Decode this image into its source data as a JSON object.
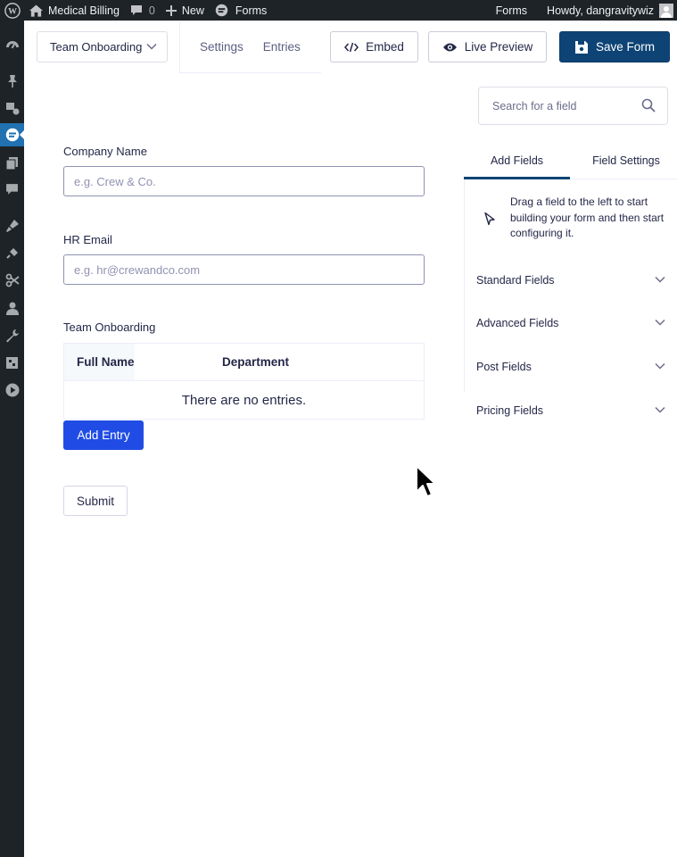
{
  "adminbar": {
    "site_name": "Medical Billing",
    "comments_count": "0",
    "new_label": "New",
    "forms_label": "Forms",
    "right_forms_label": "Forms",
    "greeting": "Howdy, dangravitywiz"
  },
  "toolbar": {
    "form_name": "Team Onboarding",
    "settings_tab": "Settings",
    "entries_tab": "Entries",
    "embed_label": "Embed",
    "preview_label": "Live Preview",
    "save_label": "Save Form"
  },
  "form": {
    "fields": [
      {
        "label": "Company Name",
        "placeholder": "e.g. Crew & Co."
      },
      {
        "label": "HR Email",
        "placeholder": "e.g. hr@crewandco.com"
      }
    ],
    "list_field": {
      "label": "Team Onboarding",
      "columns": [
        "Full Name",
        "Department"
      ],
      "empty_text": "There are no entries.",
      "add_button": "Add Entry"
    },
    "submit_label": "Submit"
  },
  "panel": {
    "search_placeholder": "Search for a field",
    "tabs": [
      "Add Fields",
      "Field Settings"
    ],
    "active_tab": "Add Fields",
    "hint": "Drag a field to the left to start building your form and then start configuring it.",
    "sections": [
      "Standard Fields",
      "Advanced Fields",
      "Post Fields",
      "Pricing Fields"
    ]
  },
  "colors": {
    "admin_bar": "#1d2327",
    "save_button": "#0e4475",
    "add_entry_button": "#204ce5",
    "active_menu": "#2271b1"
  }
}
